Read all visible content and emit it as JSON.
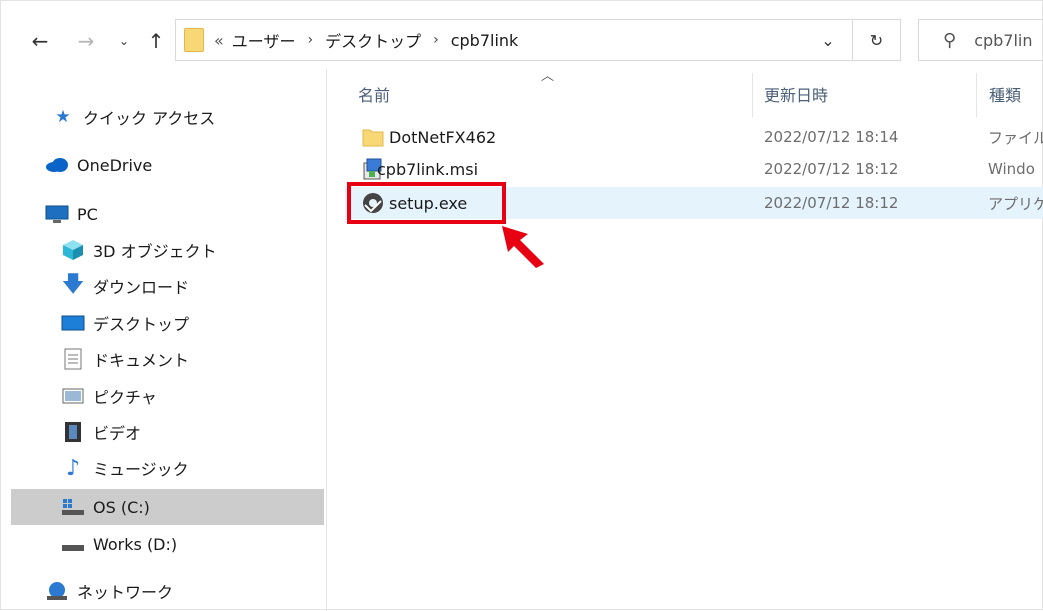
{
  "address": {
    "overflow": "«",
    "crumbs": [
      "ユーザー",
      "デスクトップ",
      "cpb7link"
    ],
    "search_placeholder": "cpb7lin"
  },
  "sidebar": {
    "items": [
      {
        "label": "クイック アクセス",
        "icon": "star-icon"
      },
      {
        "label": "OneDrive",
        "icon": "cloud-icon"
      },
      {
        "label": "PC",
        "icon": "computer-icon"
      },
      {
        "label": "3D オブジェクト",
        "icon": "cube-icon"
      },
      {
        "label": "ダウンロード",
        "icon": "download-arrow-icon"
      },
      {
        "label": "デスクトップ",
        "icon": "desktop-icon"
      },
      {
        "label": "ドキュメント",
        "icon": "document-icon"
      },
      {
        "label": "ピクチャ",
        "icon": "picture-icon"
      },
      {
        "label": "ビデオ",
        "icon": "film-icon"
      },
      {
        "label": "ミュージック",
        "icon": "music-note-icon"
      },
      {
        "label": "OS (C:)",
        "icon": "drive-c-icon",
        "selected": true
      },
      {
        "label": "Works (D:)",
        "icon": "drive-icon"
      },
      {
        "label": "ネットワーク",
        "icon": "network-icon"
      }
    ]
  },
  "columns": {
    "name": "名前",
    "date": "更新日時",
    "type": "種類"
  },
  "files": [
    {
      "name": "DotNetFX462",
      "date": "2022/07/12 18:14",
      "type": "ファイル",
      "icon": "folder-icon"
    },
    {
      "name": "cpb7link.msi",
      "date": "2022/07/12 18:12",
      "type": "Windo",
      "icon": "msi-installer-icon"
    },
    {
      "name": "setup.exe",
      "date": "2022/07/12 18:12",
      "type": "アプリケ",
      "icon": "setup-exe-icon",
      "selected": true
    }
  ],
  "colors": {
    "highlight": "#e60012",
    "selection": "#e5f3fd",
    "sidebar_selection": "#cccccc"
  }
}
